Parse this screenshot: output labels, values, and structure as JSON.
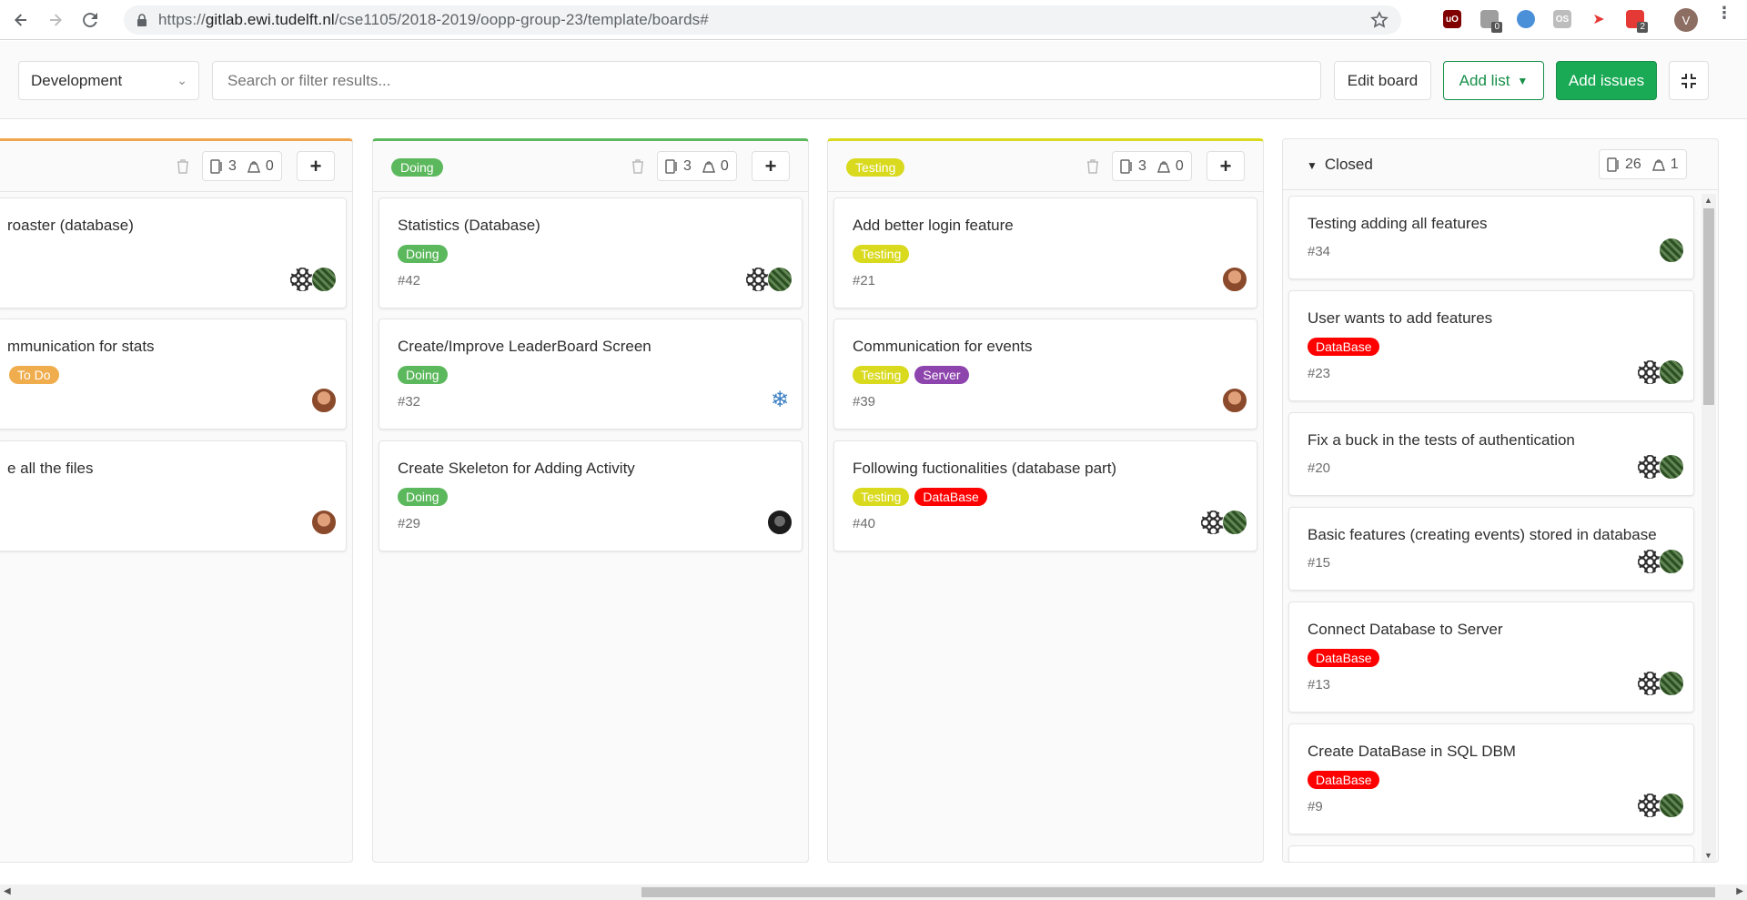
{
  "browser": {
    "url_scheme": "https://",
    "url_host": "gitlab.ewi.tudelft.nl",
    "url_path": "/cse1105/2018-2019/oopp-group-23/template/boards#",
    "ext_badge_1": "0",
    "ext_badge_2": "2",
    "ext_os_label": "OS",
    "ext_ub_label": "uO",
    "profile_initial": "V"
  },
  "header": {
    "board_name": "Development",
    "search_placeholder": "Search or filter results...",
    "edit_board": "Edit board",
    "add_list": "Add list",
    "add_issues": "Add issues"
  },
  "lists": [
    {
      "label": "",
      "issues_count": "3",
      "weight_count": "0",
      "cards": [
        {
          "title": "roaster (database)",
          "labels": [],
          "number": ""
        },
        {
          "title": "mmunication for stats",
          "labels": [
            {
              "text": "To Do",
              "color": "#f0ad4e"
            }
          ],
          "number": ""
        },
        {
          "title": "e all the files",
          "labels": [],
          "number": ""
        }
      ]
    },
    {
      "label": "Doing",
      "label_color": "#5cb85c",
      "issues_count": "3",
      "weight_count": "0",
      "cards": [
        {
          "title": "Statistics (Database)",
          "labels": [
            {
              "text": "Doing",
              "color": "#5cb85c"
            }
          ],
          "number": "#42"
        },
        {
          "title": "Create/Improve LeaderBoard Screen",
          "labels": [
            {
              "text": "Doing",
              "color": "#5cb85c"
            }
          ],
          "number": "#32"
        },
        {
          "title": "Create Skeleton for Adding Activity",
          "labels": [
            {
              "text": "Doing",
              "color": "#5cb85c"
            }
          ],
          "number": "#29"
        }
      ]
    },
    {
      "label": "Testing",
      "label_color": "#d9d91e",
      "issues_count": "3",
      "weight_count": "0",
      "cards": [
        {
          "title": "Add better login feature",
          "labels": [
            {
              "text": "Testing",
              "color": "#d9d91e"
            }
          ],
          "number": "#21"
        },
        {
          "title": "Communication for events",
          "labels": [
            {
              "text": "Testing",
              "color": "#d9d91e"
            },
            {
              "text": "Server",
              "color": "#8e44ad"
            }
          ],
          "number": "#39"
        },
        {
          "title": "Following fuctionalities (database part)",
          "labels": [
            {
              "text": "Testing",
              "color": "#d9d91e"
            },
            {
              "text": "DataBase",
              "color": "#ff0000"
            }
          ],
          "number": "#40"
        }
      ]
    },
    {
      "label": "Closed",
      "issues_count": "26",
      "weight_count": "1",
      "cards": [
        {
          "title": "Testing adding all features",
          "labels": [],
          "number": "#34"
        },
        {
          "title": "User wants to add features",
          "labels": [
            {
              "text": "DataBase",
              "color": "#ff0000"
            }
          ],
          "number": "#23"
        },
        {
          "title": "Fix a buck in the tests of authentication",
          "labels": [],
          "number": "#20"
        },
        {
          "title": "Basic features (creating events) stored in database",
          "labels": [],
          "number": "#15"
        },
        {
          "title": "Connect Database to Server",
          "labels": [
            {
              "text": "DataBase",
              "color": "#ff0000"
            }
          ],
          "number": "#13"
        },
        {
          "title": "Create DataBase in SQL DBM",
          "labels": [
            {
              "text": "DataBase",
              "color": "#ff0000"
            }
          ],
          "number": "#9"
        }
      ]
    }
  ]
}
